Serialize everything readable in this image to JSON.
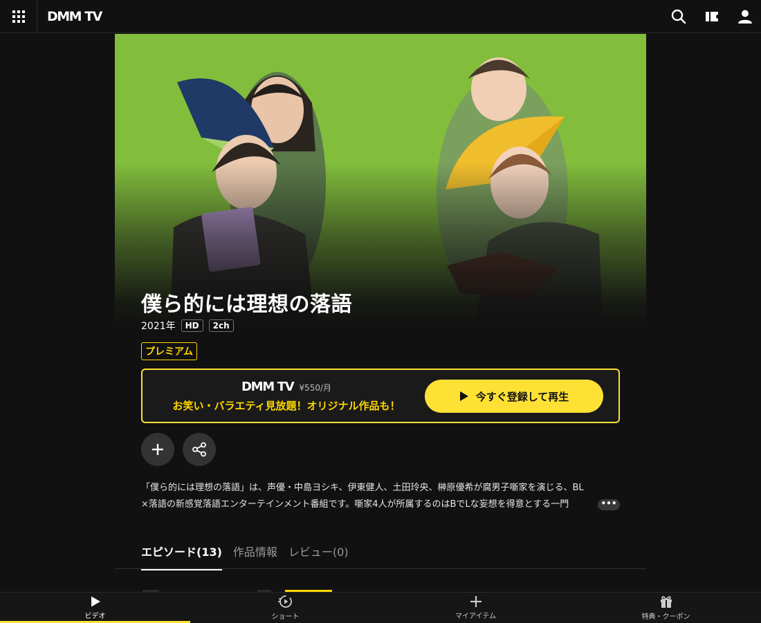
{
  "header": {
    "logo": "DMM TV",
    "icons": [
      "apps-grid-icon",
      "search-icon",
      "ticket-icon",
      "user-icon"
    ]
  },
  "title": "僕ら的には理想の落語",
  "meta": {
    "year": "2021年",
    "badges": [
      "HD",
      "2ch"
    ]
  },
  "premium_label": "プレミアム",
  "promo": {
    "logo": "DMM TV",
    "price": "¥550/月",
    "tagline": "お笑い・バラエティ見放題！オリジナル作品も！",
    "cta_label": "今すぐ登録して再生",
    "colors": {
      "accent": "#ffe135",
      "tagline": "#ffd700"
    }
  },
  "actions": {
    "add_icon": "plus-icon",
    "share_icon": "share-icon"
  },
  "description": {
    "line1": "「僕ら的には理想の落語」は、声優・中島ヨシキ、伊東健人、土田玲央、榊原優希が腐男子噺家を演じる、BL",
    "line2": "×落語の新感覚落語エンターテインメント番組です。噺家4人が所属するのはBでLな妄想を得意とする一門",
    "more_label": "•••"
  },
  "tabs": [
    {
      "label": "エピソード(13)",
      "active": true
    },
    {
      "label": "作品情報",
      "active": false
    },
    {
      "label": "レビュー(0)",
      "active": false
    }
  ],
  "bottom_nav": [
    {
      "label": "ビデオ",
      "icon": "play-icon",
      "active": true
    },
    {
      "label": "ショート",
      "icon": "short-video-icon",
      "active": false
    },
    {
      "label": "マイアイテム",
      "icon": "plus-icon",
      "active": false
    },
    {
      "label": "特典・クーポン",
      "icon": "gift-icon",
      "active": false
    }
  ],
  "hero_bg_color": "#82be3c"
}
